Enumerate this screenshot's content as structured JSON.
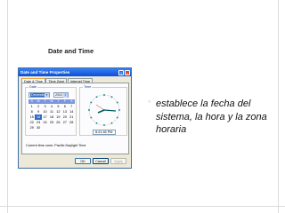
{
  "slide": {
    "title": "Date and Time",
    "bullet_symbol": "◦",
    "bullet_text": "establece la fecha del sistema, la hora y la zona horaria"
  },
  "dialog": {
    "title": "Date and Time Properties",
    "titlebar_buttons": {
      "help": "?",
      "close": "×"
    },
    "tabs": [
      {
        "label": "Date & Time",
        "active": true
      },
      {
        "label": "Time Zone",
        "active": false
      },
      {
        "label": "Internet Time",
        "active": false
      }
    ],
    "date_group": {
      "label": "Date",
      "month": "December",
      "year": "2002",
      "weekday_headers": [
        "S",
        "M",
        "T",
        "W",
        "T",
        "F",
        "S"
      ],
      "weeks": [
        [
          "1",
          "2",
          "3",
          "4",
          "5",
          "6",
          "7"
        ],
        [
          "8",
          "9",
          "10",
          "11",
          "12",
          "13",
          "14"
        ],
        [
          "15",
          "16",
          "17",
          "18",
          "19",
          "20",
          "21"
        ],
        [
          "22",
          "23",
          "24",
          "25",
          "26",
          "27",
          "28"
        ],
        [
          "29",
          "30",
          "",
          "",
          "",
          "",
          ""
        ]
      ],
      "selected_day": "16"
    },
    "time_group": {
      "label": "Time",
      "time_value": "8:41:46 PM"
    },
    "timezone_status": "Current time zone:  Pacific Daylight Time",
    "buttons": {
      "ok": "OK",
      "cancel": "Cancel",
      "apply": "Apply"
    },
    "colors": {
      "titlebar": "#0a4fd6",
      "clock_hands": "#005a5a"
    }
  }
}
